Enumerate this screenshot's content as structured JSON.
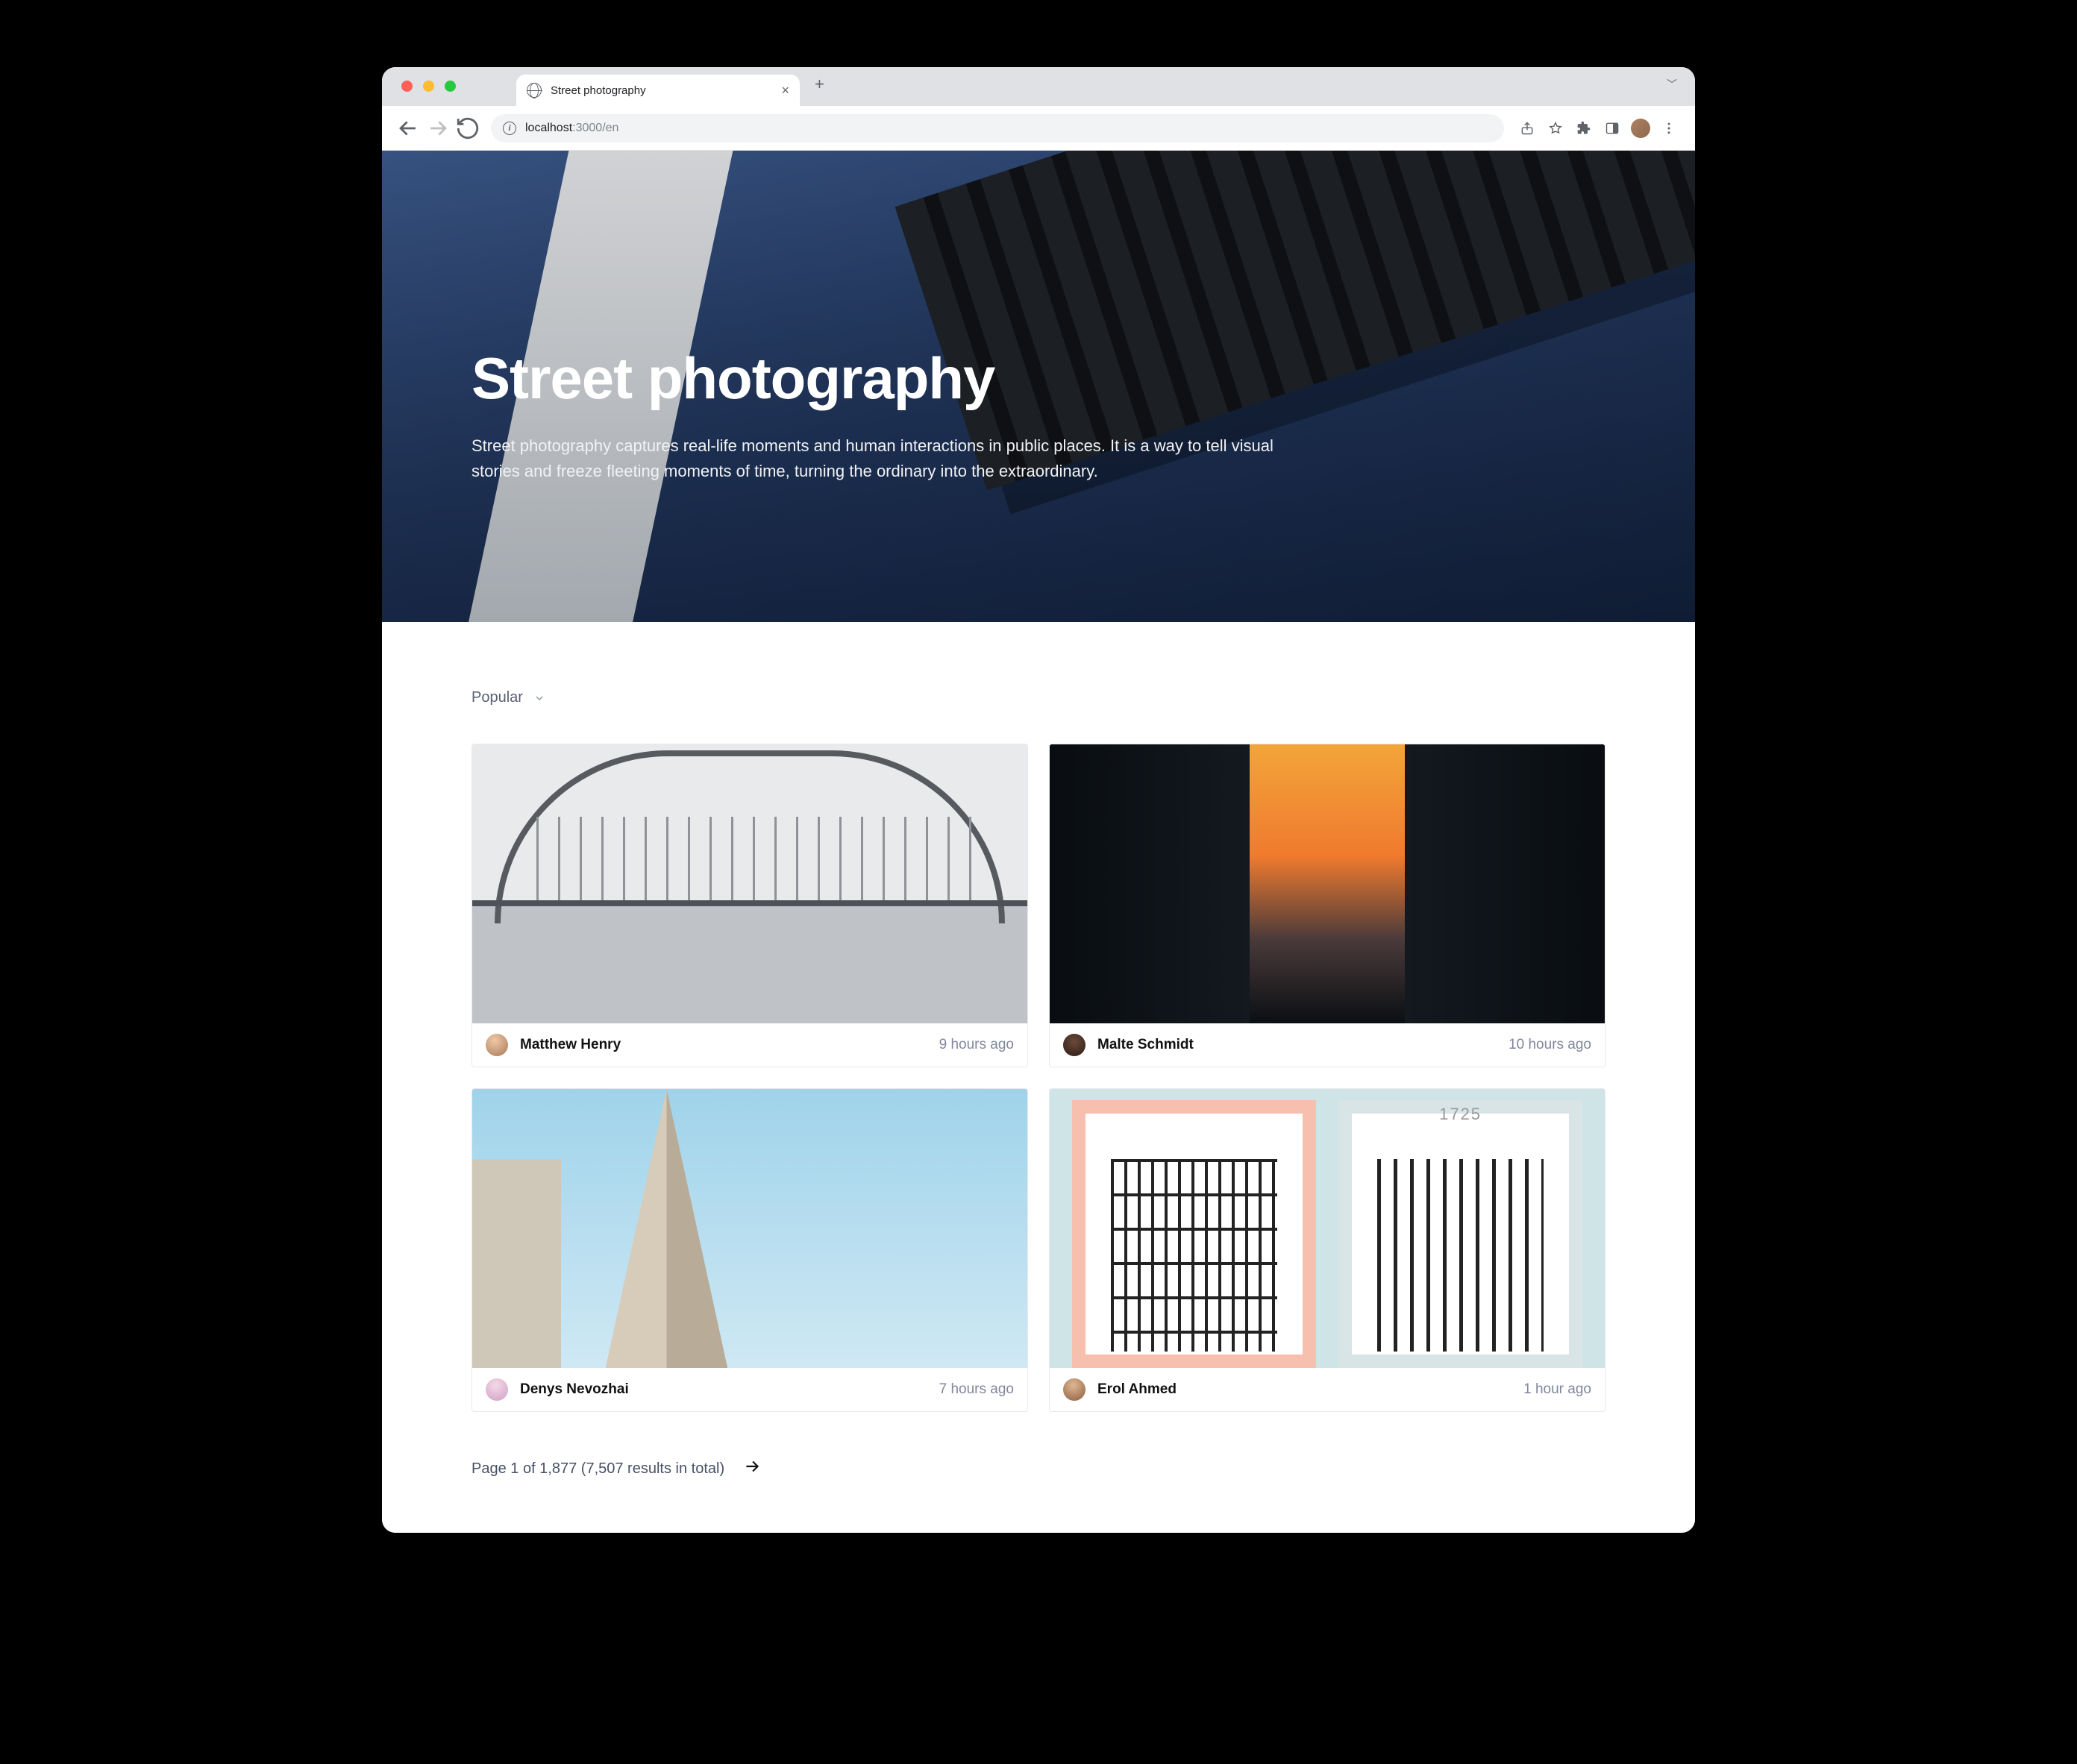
{
  "browser": {
    "tab_title": "Street photography",
    "url_host": "localhost",
    "url_path": ":3000/en"
  },
  "hero": {
    "title": "Street photography",
    "description": "Street photography captures real-life moments and human interactions in public places. It is a way to tell visual stories and freeze fleeting moments of time, turning the ordinary into the extraordinary."
  },
  "sort": {
    "selected": "Popular"
  },
  "cards": [
    {
      "author": "Matthew Henry",
      "time": "9 hours ago"
    },
    {
      "author": "Malte Schmidt",
      "time": "10 hours ago"
    },
    {
      "author": "Denys Nevozhai",
      "time": "7 hours ago"
    },
    {
      "author": "Erol Ahmed",
      "time": "1 hour ago"
    }
  ],
  "pager": {
    "text": "Page 1 of 1,877 (7,507 results in total)",
    "page": 1,
    "total_pages": 1877,
    "total_results": 7507
  },
  "door_number_right": "1725"
}
